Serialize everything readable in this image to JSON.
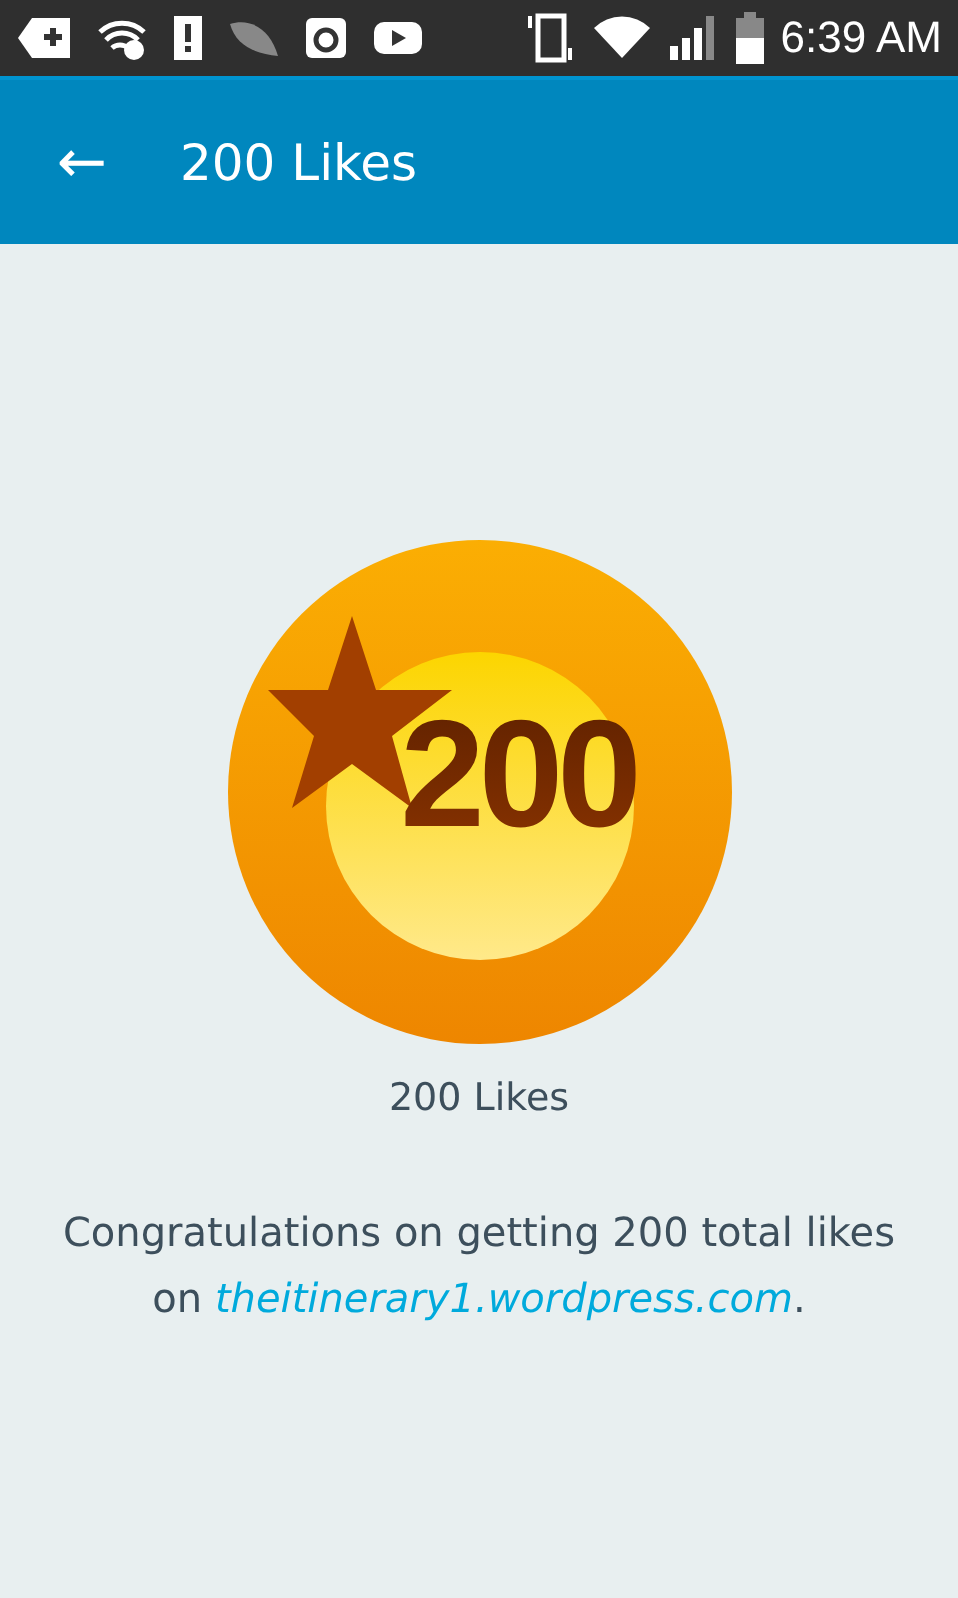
{
  "status_bar": {
    "time": "6:39 AM"
  },
  "app_bar": {
    "back": "←",
    "title": "200 Likes"
  },
  "badge": {
    "number": "200"
  },
  "badge_label": "200 Likes",
  "message": {
    "before": "Congratulations on getting 200 total likes on ",
    "link": "theitinerary1.wordpress.com",
    "after": "."
  }
}
